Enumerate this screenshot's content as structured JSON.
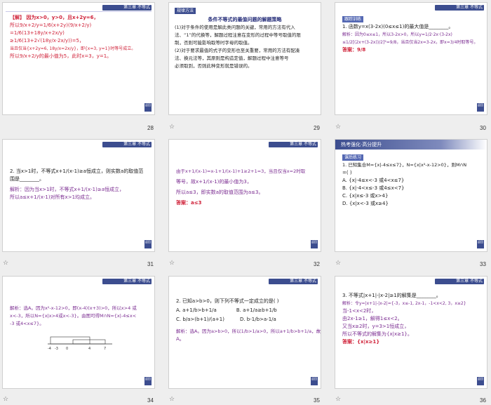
{
  "header_text": "第三章  不等式",
  "return_label": "返回",
  "colors": {
    "accent": "#3c4d8f",
    "red": "#d0233a",
    "purple": "#7b2c91",
    "blue": "#222a77"
  },
  "slides": [
    {
      "page": "28",
      "lines": [
        "【解】 因为x>0，y>0，且x+2y=6，",
        "所以9/x+2/y=1/6(x+2y)(9/x+2/y)",
        "=1/6(13+18y/x+2x/y)",
        "≥1/6(13+2√(18y/x·2x/y))=5，",
        "当且仅当{x+2y=6, 18y/x=2x/y}，即{x=3, y=1}时等号成立。",
        "所以9/x+2/y的最小值为5，此时x=3，y=1。"
      ]
    },
    {
      "page": "29",
      "tag": "规律方法",
      "title": "条件不等式的最值问题的解题策略",
      "lines": [
        "(1)对于条件的使用是解此类问题的关键，常用的方法有代入",
        "法、“1”的代换等，解题过程注意在变形的过程中等号取值的限",
        "制，否则可能影响取等时字母的取值。",
        "(2)对于要求最值的式子的变形也至关重要，常用的方法有配凑",
        "法、换元法等，其原则是构造定值，解题过程中注意等号",
        "必须取到，否则此种变形就是错误的。"
      ]
    },
    {
      "page": "30",
      "tag": "跟踪训练",
      "q": "1. 函数y=x(3-2x)(0≤x≤1)的最大值是________。",
      "lines": [
        "解析：因为0≤x≤1，所以3-2x>0，所以y=1/2·2x·(3-2x)",
        "≤1/2[(2x+(3-2x))/2]²=9/8，当且仅当2x=3-2x，即x=3/4时取等号。"
      ],
      "answer": "答案：9/8"
    },
    {
      "page": "31",
      "q": "2. 当x>1时，不等式x+1/(x-1)≥a恒成立，则实数a的取值范",
      "q2": "围是________。",
      "lines": [
        "解析：因为当x>1时，不等式x+1/(x-1)≥a恒成立，",
        "所以a≤x+1/(x-1)对所有x>1均成立。"
      ]
    },
    {
      "page": "32",
      "lines": [
        "由于x+1/(x-1)=x-1+1/(x-1)+1≥2+1=3，当且仅当x=2时取",
        "等号，故x+1/(x-1)的最小值为3，",
        "所以a≤3，即实数a的取值范围为a≤3。"
      ],
      "answer": "答案：a≤3"
    },
    {
      "page": "33",
      "banner": "热考强化·高分提升",
      "tag": "课后练习",
      "q": "1. 已知集合M={x|-4≤x≤7}，N={x|x²-x-12>0}，则M∩N",
      "q2": "=(      )",
      "options": [
        "A. {x|-4≤x<-3 或4<x≤7}",
        "B. {x|-4<x≤-3 或4≤x<7}",
        "C. {x|x≤-3 或x>4}",
        "D. {x|x<-3 或x≥4}"
      ]
    },
    {
      "page": "34",
      "lines": [
        "解析：选A。因为x²-x-12>0，即(x-4)(x+3)>0，所以x>4 或",
        "x<-3，所以N={x|x>4或x<-3}。由图可得M∩N={x|-4≤x<",
        "-3 或4<x≤7}。"
      ],
      "numberline_labels": [
        "-4",
        "-3",
        "0",
        "4",
        "7"
      ]
    },
    {
      "page": "35",
      "q": "2. 已知a>b>0，则下列不等式一定成立的是(      )",
      "options": [
        "A. a+1/b>b+1/a",
        "B. a+1/a≥b+1/b",
        "C. b/a>(b+1)/(a+1)",
        "D. b-1/b>a-1/a"
      ],
      "lines": [
        "解析：选A。因为a>b>0，所以1/b>1/a>0，所以a+1/b>b+1/a，故选",
        "A。"
      ]
    },
    {
      "page": "36",
      "q": "3. 不等式|x+1|-|x-2|≥1的解集是________。",
      "lines": [
        "解析：令y=|x+1|-|x-2|={-3，x≤-1, 2x-1，-1<x<2, 3，x≥2}",
        "当-1<x<2时，",
        "由2x-1≥1，解得1≤x<2。",
        "又当x≥2时，y=3>1恒成立，",
        "所以不等式的解集为{x|x≥1}。"
      ],
      "answer": "答案：{x|x≥1}"
    }
  ]
}
